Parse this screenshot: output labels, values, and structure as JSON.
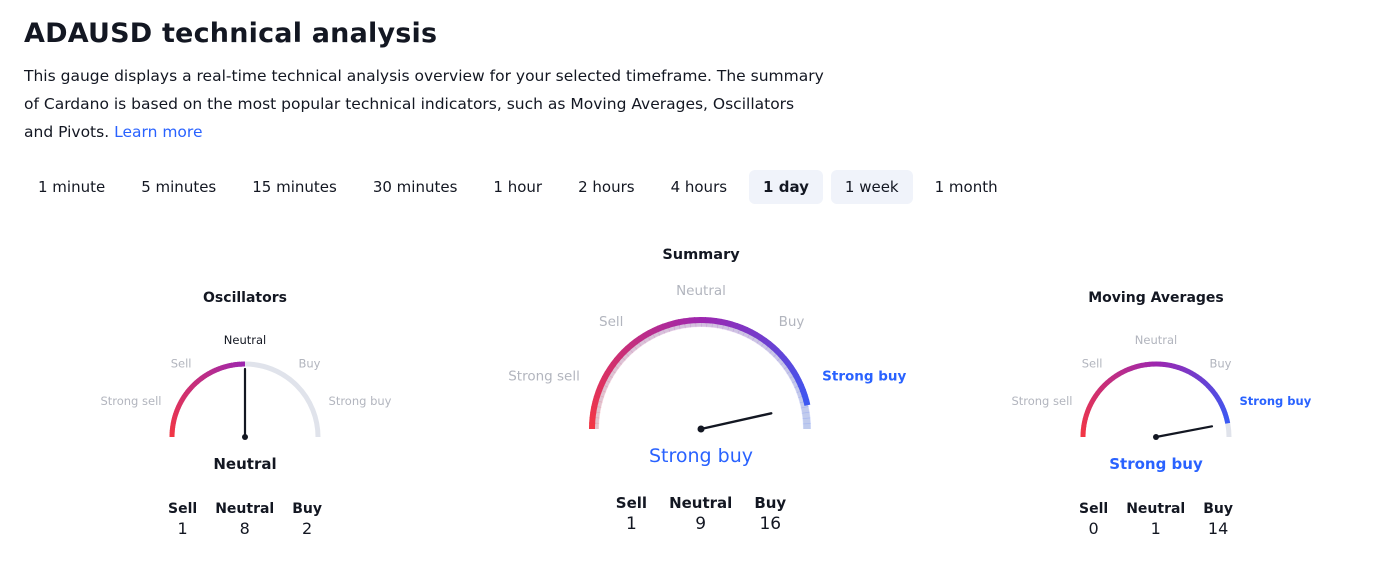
{
  "header": {
    "title": "ADAUSD technical analysis",
    "description": "This gauge displays a real-time technical analysis overview for your selected timeframe. The summary of Cardano is based on the most popular technical indicators, such as Moving Averages, Oscillators and Pivots.",
    "learn_more": "Learn more"
  },
  "timeframes": [
    "1 minute",
    "5 minutes",
    "15 minutes",
    "30 minutes",
    "1 hour",
    "2 hours",
    "4 hours",
    "1 day",
    "1 week",
    "1 month"
  ],
  "selected_timeframe": "1 day",
  "zone_labels": {
    "strong_sell": "Strong sell",
    "sell": "Sell",
    "neutral": "Neutral",
    "buy": "Buy",
    "strong_buy": "Strong buy"
  },
  "colors": {
    "sell_red": "#f23645",
    "neutral_purple": "#9c27b0",
    "buy_blue": "#2962ff",
    "track": "#e0e3eb",
    "verdict_blue": "#2962ff"
  },
  "gauges": {
    "oscillators": {
      "title": "Oscillators",
      "verdict": "Neutral",
      "reading": 0.5,
      "counts": {
        "sell_label": "Sell",
        "sell": "1",
        "neutral_label": "Neutral",
        "neutral": "8",
        "buy_label": "Buy",
        "buy": "2"
      }
    },
    "summary": {
      "title": "Summary",
      "verdict": "Strong buy",
      "reading": 0.93,
      "counts": {
        "sell_label": "Sell",
        "sell": "1",
        "neutral_label": "Neutral",
        "neutral": "9",
        "buy_label": "Buy",
        "buy": "16"
      }
    },
    "moving_averages": {
      "title": "Moving Averages",
      "verdict": "Strong buy",
      "reading": 0.94,
      "counts": {
        "sell_label": "Sell",
        "sell": "0",
        "neutral_label": "Neutral",
        "neutral": "1",
        "buy_label": "Buy",
        "buy": "14"
      }
    }
  }
}
